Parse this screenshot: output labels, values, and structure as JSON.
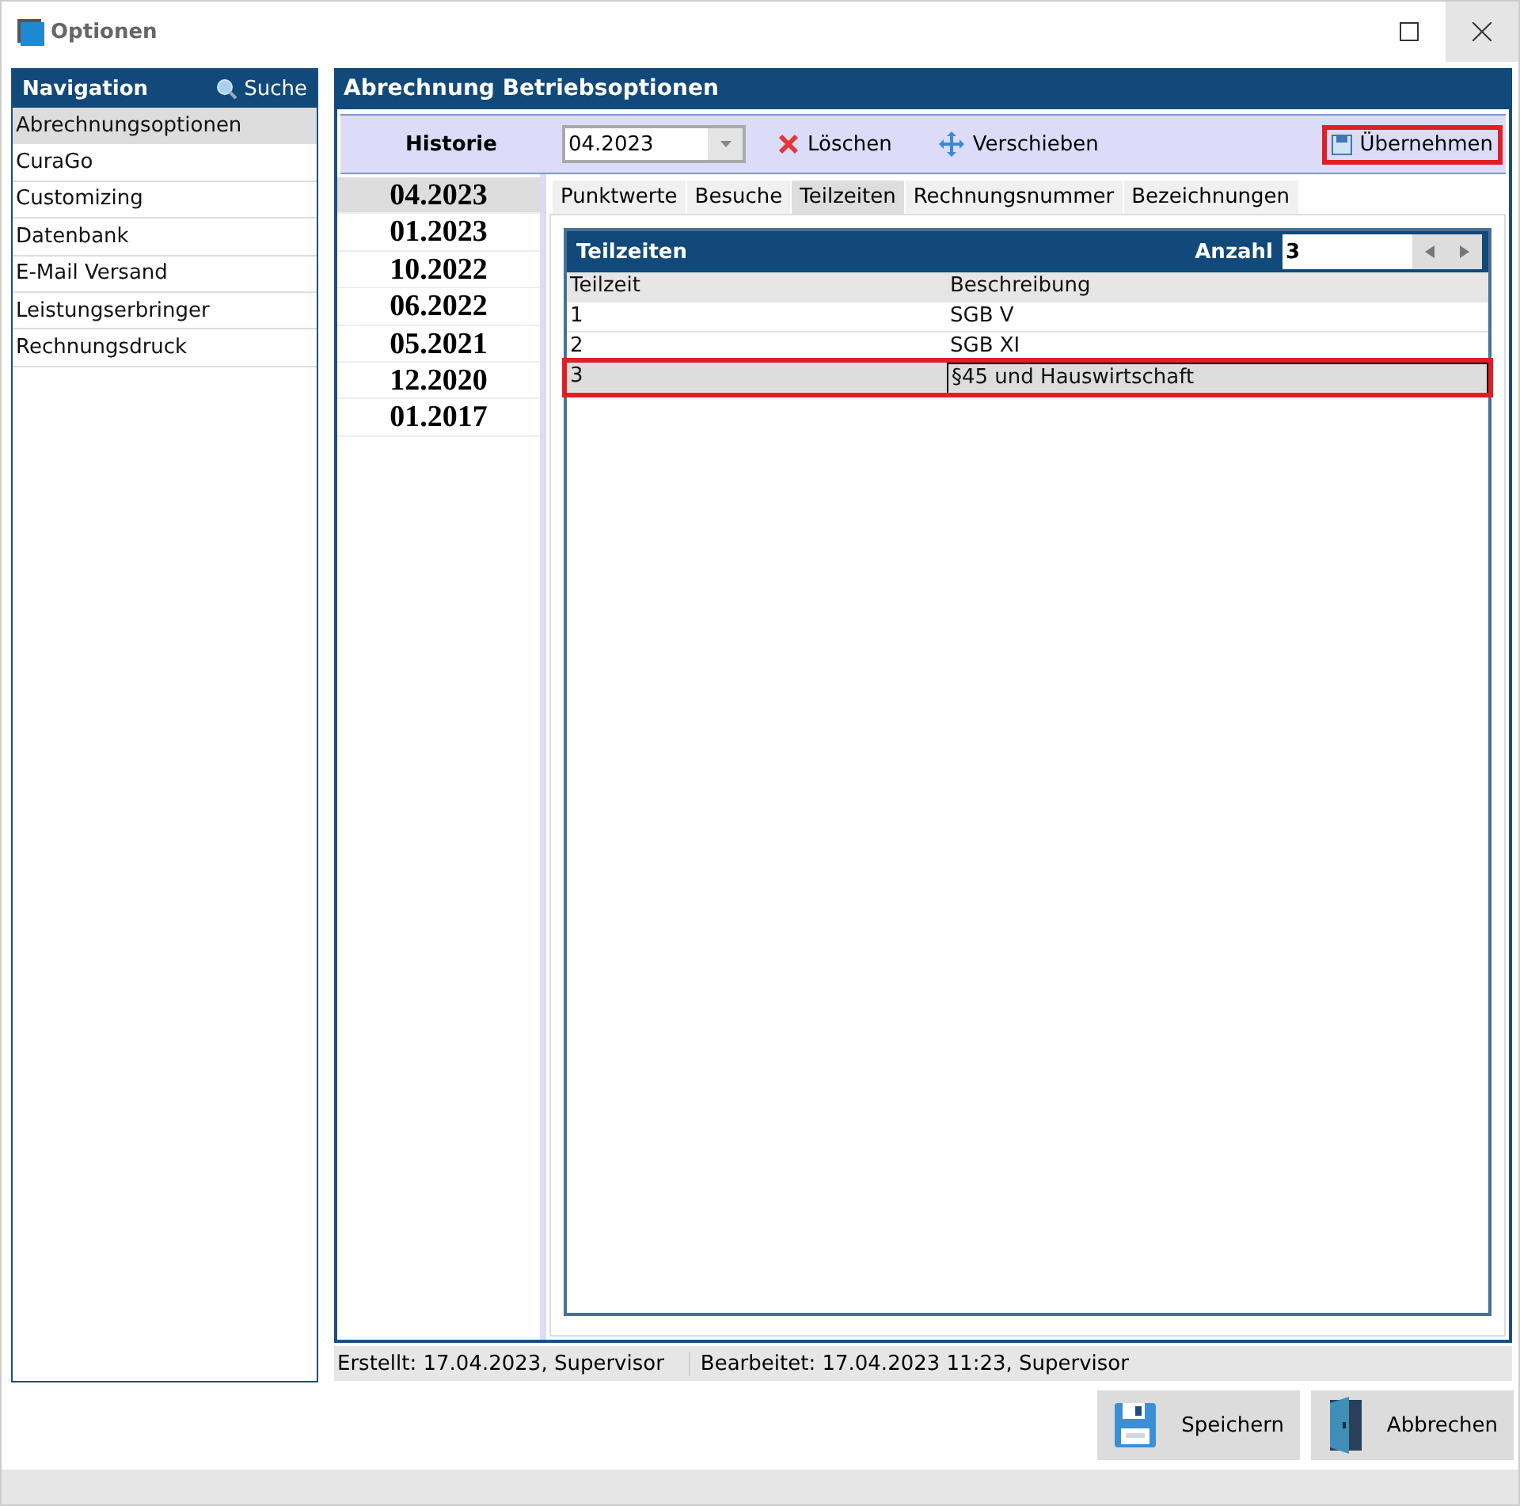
{
  "window": {
    "title": "Optionen"
  },
  "navigation": {
    "title": "Navigation",
    "search_label": "Suche",
    "items": [
      {
        "label": "Abrechnungsoptionen",
        "selected": true
      },
      {
        "label": "CuraGo",
        "selected": false
      },
      {
        "label": "Customizing",
        "selected": false
      },
      {
        "label": "Datenbank",
        "selected": false
      },
      {
        "label": "E-Mail Versand",
        "selected": false
      },
      {
        "label": "Leistungserbringer",
        "selected": false
      },
      {
        "label": "Rechnungsdruck",
        "selected": false
      }
    ]
  },
  "panel": {
    "title": "Abrechnung Betriebsoptionen"
  },
  "toolbar": {
    "history_label": "Historie",
    "history_value": "04.2023",
    "delete_label": "Löschen",
    "move_label": "Verschieben",
    "apply_label": "Übernehmen",
    "apply_highlighted": true
  },
  "history": [
    {
      "label": "04.2023",
      "selected": true
    },
    {
      "label": "01.2023",
      "selected": false
    },
    {
      "label": "10.2022",
      "selected": false
    },
    {
      "label": "06.2022",
      "selected": false
    },
    {
      "label": "05.2021",
      "selected": false
    },
    {
      "label": "12.2020",
      "selected": false
    },
    {
      "label": "01.2017",
      "selected": false
    }
  ],
  "tabs": [
    {
      "label": "Punktwerte",
      "selected": false
    },
    {
      "label": "Besuche",
      "selected": false
    },
    {
      "label": "Teilzeiten",
      "selected": true
    },
    {
      "label": "Rechnungsnummer",
      "selected": false
    },
    {
      "label": "Bezeichnungen",
      "selected": false
    }
  ],
  "table": {
    "title": "Teilzeiten",
    "count_label": "Anzahl",
    "count_value": "3",
    "columns": [
      "Teilzeit",
      "Beschreibung"
    ],
    "rows": [
      {
        "cells": [
          "1",
          "SGB V"
        ],
        "selected": false,
        "highlighted": false
      },
      {
        "cells": [
          "2",
          "SGB XI"
        ],
        "selected": false,
        "highlighted": false
      },
      {
        "cells": [
          "3",
          "§45 und Hauswirtschaft"
        ],
        "selected": true,
        "highlighted": true
      }
    ]
  },
  "status_bar": {
    "created": "Erstellt: 17.04.2023, Supervisor",
    "edited": "Bearbeitet: 17.04.2023 11:23, Supervisor"
  },
  "buttons": [
    {
      "label": "Speichern",
      "kind": "save"
    },
    {
      "label": "Abbrechen",
      "kind": "cancel"
    }
  ]
}
